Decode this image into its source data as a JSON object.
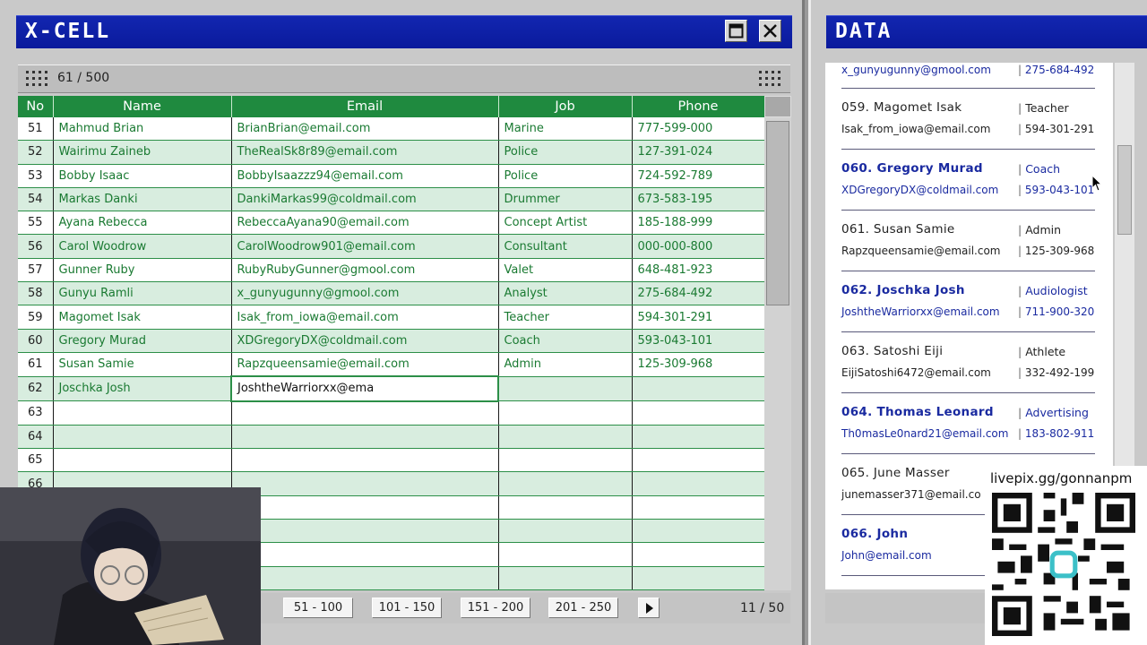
{
  "xcell": {
    "title": "X-CELL",
    "record_count": "61 / 500",
    "columns": [
      "No",
      "Name",
      "Email",
      "Job",
      "Phone"
    ],
    "rows": [
      {
        "no": "51",
        "name": "Mahmud Brian",
        "email": "BrianBrian@email.com",
        "job": "Marine",
        "phone": "777-599-000"
      },
      {
        "no": "52",
        "name": "Wairimu Zaineb",
        "email": "TheRealSk8r89@email.com",
        "job": "Police",
        "phone": "127-391-024"
      },
      {
        "no": "53",
        "name": "Bobby Isaac",
        "email": "BobbyIsaazzz94@email.com",
        "job": "Police",
        "phone": "724-592-789"
      },
      {
        "no": "54",
        "name": "Markas Danki",
        "email": "DankiMarkas99@coldmail.com",
        "job": "Drummer",
        "phone": "673-583-195"
      },
      {
        "no": "55",
        "name": "Ayana Rebecca",
        "email": "RebeccaAyana90@email.com",
        "job": "Concept Artist",
        "phone": "185-188-999"
      },
      {
        "no": "56",
        "name": "Carol Woodrow",
        "email": "CarolWoodrow901@email.com",
        "job": "Consultant",
        "phone": "000-000-800"
      },
      {
        "no": "57",
        "name": "Gunner Ruby",
        "email": "RubyRubyGunner@gmool.com",
        "job": "Valet",
        "phone": "648-481-923"
      },
      {
        "no": "58",
        "name": "Gunyu Ramli",
        "email": "x_gunyugunny@gmool.com",
        "job": "Analyst",
        "phone": "275-684-492"
      },
      {
        "no": "59",
        "name": "Magomet Isak",
        "email": "Isak_from_iowa@email.com",
        "job": "Teacher",
        "phone": "594-301-291"
      },
      {
        "no": "60",
        "name": "Gregory Murad",
        "email": "XDGregoryDX@coldmail.com",
        "job": "Coach",
        "phone": "593-043-101"
      },
      {
        "no": "61",
        "name": "Susan Samie",
        "email": "Rapzqueensamie@email.com",
        "job": "Admin",
        "phone": "125-309-968"
      },
      {
        "no": "62",
        "name": "Joschka Josh",
        "email": "JoshtheWarriorxx@ema",
        "job": "",
        "phone": ""
      },
      {
        "no": "63",
        "name": "",
        "email": "",
        "job": "",
        "phone": ""
      },
      {
        "no": "64",
        "name": "",
        "email": "",
        "job": "",
        "phone": ""
      },
      {
        "no": "65",
        "name": "",
        "email": "",
        "job": "",
        "phone": ""
      },
      {
        "no": "66",
        "name": "",
        "email": "",
        "job": "",
        "phone": ""
      },
      {
        "no": "",
        "name": "",
        "email": "",
        "job": "",
        "phone": ""
      },
      {
        "no": "",
        "name": "",
        "email": "",
        "job": "",
        "phone": ""
      },
      {
        "no": "",
        "name": "",
        "email": "",
        "job": "",
        "phone": ""
      },
      {
        "no": "",
        "name": "",
        "email": "",
        "job": "",
        "phone": ""
      }
    ],
    "pager": {
      "pages": [
        "51 - 100",
        "101 - 150",
        "151 - 200",
        "201 - 250"
      ],
      "page_count": "11 / 50"
    }
  },
  "data_panel": {
    "title": "DATA",
    "entries": [
      {
        "style": "blue",
        "name": "",
        "job": "",
        "email": "x_gunyugunny@gmool.com",
        "phone": "275-684-492"
      },
      {
        "style": "black",
        "name": "059. Magomet Isak",
        "job": "Teacher",
        "email": "Isak_from_iowa@email.com",
        "phone": "594-301-291"
      },
      {
        "style": "blue",
        "name": "060. Gregory Murad",
        "job": "Coach",
        "email": "XDGregoryDX@coldmail.com",
        "phone": "593-043-101"
      },
      {
        "style": "black",
        "name": "061. Susan Samie",
        "job": "Admin",
        "email": "Rapzqueensamie@email.com",
        "phone": "125-309-968"
      },
      {
        "style": "blue",
        "name": "062. Joschka Josh",
        "job": "Audiologist",
        "email": "JoshtheWarriorxx@email.com",
        "phone": "711-900-320"
      },
      {
        "style": "black",
        "name": "063. Satoshi Eiji",
        "job": "Athlete",
        "email": "EijiSatoshi6472@email.com",
        "phone": "332-492-199"
      },
      {
        "style": "blue",
        "name": "064. Thomas Leonard",
        "job": "Advertising",
        "email": "Th0masLe0nard21@email.com",
        "phone": "183-802-911"
      },
      {
        "style": "black",
        "name": "065. June Masser",
        "job": "",
        "email": "junemasser371@email.co",
        "phone": ""
      },
      {
        "style": "blue",
        "name": "066. John",
        "job": "",
        "email": "John@email.com",
        "phone": ""
      }
    ]
  },
  "overlay": {
    "qr_url": "livepix.gg/gonnanpm"
  },
  "colors": {
    "titlebar": "#0a1a9c",
    "header_green": "#1f8a3f",
    "row_alt": "#d8eddf",
    "text_green": "#1a7a32",
    "data_blue": "#1a2aa0"
  }
}
